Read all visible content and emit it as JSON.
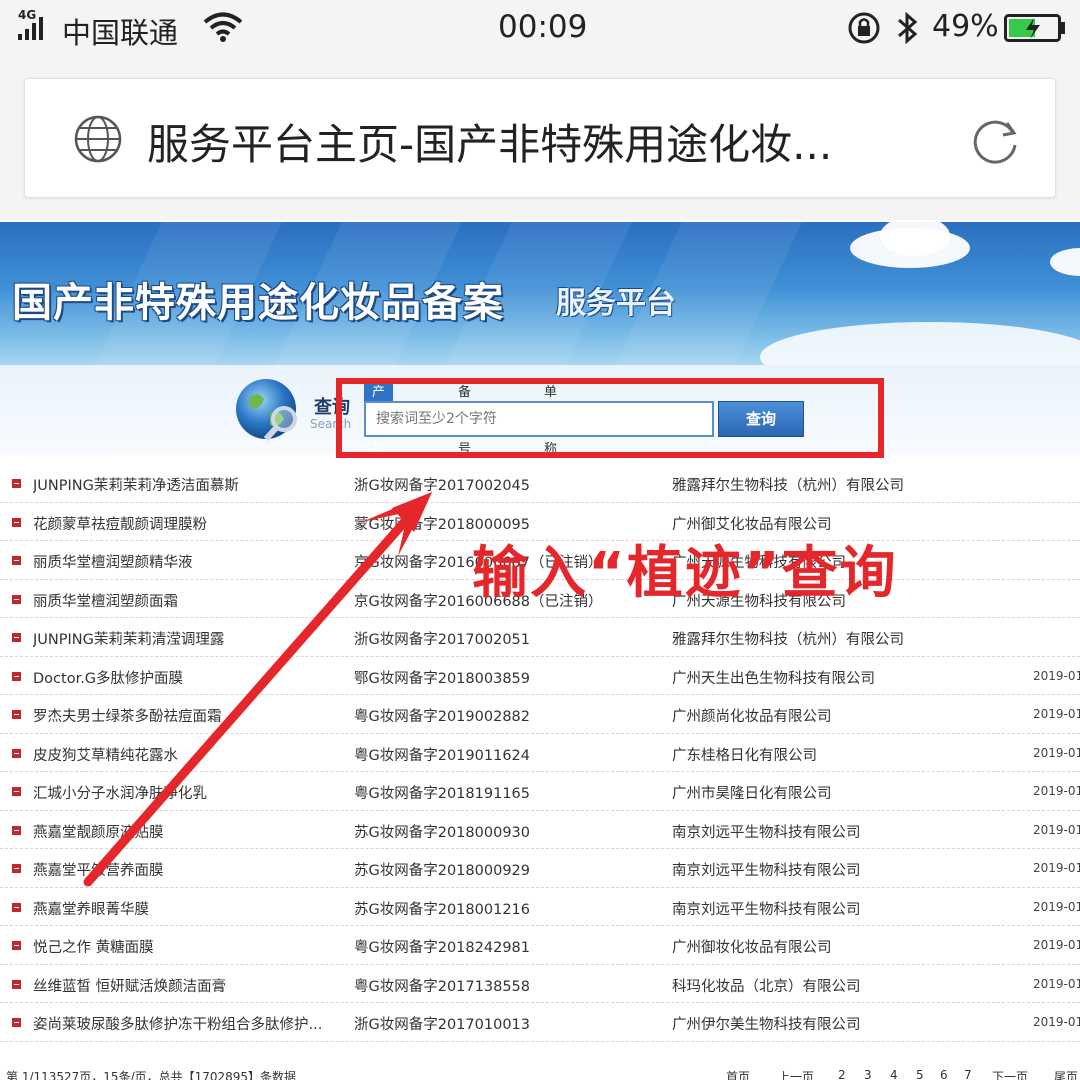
{
  "status_bar": {
    "network": "4G",
    "carrier": "中国联通",
    "time": "00:09",
    "battery_percent": "49%",
    "icons": [
      "signal-icon",
      "wifi-icon",
      "rotation-lock-icon",
      "bluetooth-icon",
      "battery-charging-icon"
    ]
  },
  "browser": {
    "page_title": "服务平台主页-国产非特殊用途化妆...",
    "icons": [
      "globe-icon",
      "reload-icon"
    ]
  },
  "banner": {
    "title": "国产非特殊用途化妆品备案",
    "subtitle": "服务平台"
  },
  "search": {
    "label_cn": "查询",
    "label_en": "Search",
    "tabs": [
      "产品名称",
      "备案编号",
      "单位名称"
    ],
    "active_tab": "产品名称",
    "placeholder": "搜索词至少2个字符",
    "button_label": "查询"
  },
  "annotation": {
    "text": "输入“植迹”查询",
    "color": "#e5262b"
  },
  "records": [
    {
      "name": "JUNPING茉莉茉莉净透洁面慕斯",
      "code": "浙G妆网备字2017002045",
      "company": "雅露拜尔生物科技（杭州）有限公司",
      "date": ""
    },
    {
      "name": "花颜蒙草祛痘靓颜调理膜粉",
      "code": "蒙G妆网备字2018000095",
      "company": "广州御艾化妆品有限公司",
      "date": ""
    },
    {
      "name": "丽质华堂檀润塑颜精华液",
      "code": "京G妆网备字2016006687（已注销）",
      "company": "广州天源生物科技有限公司",
      "date": ""
    },
    {
      "name": "丽质华堂檀润塑颜面霜",
      "code": "京G妆网备字2016006688（已注销）",
      "company": "广州天源生物科技有限公司",
      "date": ""
    },
    {
      "name": "JUNPING茉莉茉莉清滢调理露",
      "code": "浙G妆网备字2017002051",
      "company": "雅露拜尔生物科技（杭州）有限公司",
      "date": ""
    },
    {
      "name": "Doctor.G多肽修护面膜",
      "code": "鄂G妆网备字2018003859",
      "company": "广州天生出色生物科技有限公司",
      "date": "2019-01-"
    },
    {
      "name": "罗杰夫男士绿茶多酚祛痘面霜",
      "code": "粤G妆网备字2019002882",
      "company": "广州颜尚化妆品有限公司",
      "date": "2019-01-"
    },
    {
      "name": "皮皮狗艾草精纯花露水",
      "code": "粤G妆网备字2019011624",
      "company": "广东桂格日化有限公司",
      "date": "2019-01-"
    },
    {
      "name": "汇城小分子水润净肤净化乳",
      "code": "粤G妆网备字2018191165",
      "company": "广州市昊隆日化有限公司",
      "date": "2019-01-"
    },
    {
      "name": "燕嘉堂靓颜原液贴膜",
      "code": "苏G妆网备字2018000930",
      "company": "南京刘远平生物科技有限公司",
      "date": "2019-01-"
    },
    {
      "name": "燕嘉堂平皱营养面膜",
      "code": "苏G妆网备字2018000929",
      "company": "南京刘远平生物科技有限公司",
      "date": "2019-01-"
    },
    {
      "name": "燕嘉堂养眼菁华膜",
      "code": "苏G妆网备字2018001216",
      "company": "南京刘远平生物科技有限公司",
      "date": "2019-01-"
    },
    {
      "name": "悦己之作 黄糖面膜",
      "code": "粤G妆网备字2018242981",
      "company": "广州御妆化妆品有限公司",
      "date": "2019-01-"
    },
    {
      "name": "丝维蓝皙 恒妍赋活焕颜洁面膏",
      "code": "粤G妆网备字2017138558",
      "company": "科玛化妆品（北京）有限公司",
      "date": "2019-01-"
    },
    {
      "name": "姿尚莱玻尿酸多肽修护冻干粉组合多肽修护...",
      "code": "浙G妆网备字2017010013",
      "company": "广州伊尔美生物科技有限公司",
      "date": "2019-01-"
    }
  ],
  "footer": {
    "summary": "第 1/113527页，15条/页，总共【1702895】条数据",
    "pager": [
      "首页",
      "上一页",
      "2",
      "3",
      "4",
      "5",
      "6",
      "7",
      "下一页",
      "尾页"
    ]
  }
}
